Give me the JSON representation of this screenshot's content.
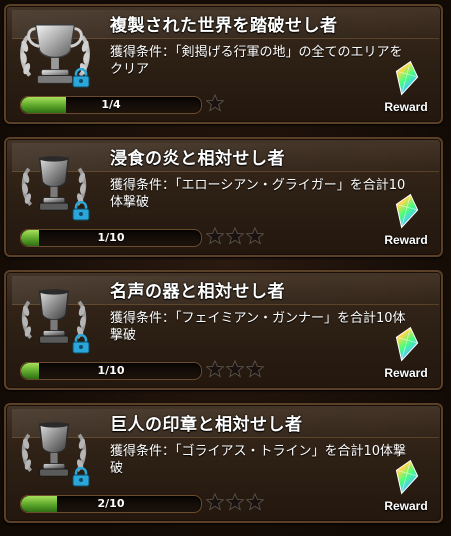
{
  "cards": [
    {
      "title": "複製された世界を踏破せし者",
      "condition": "獲得条件：「剣揭げる行軍の地」の全てのエリアをクリア",
      "progress_text": "1/4",
      "progress_fraction": 0.25,
      "stars": 1,
      "reward_label": "Reward",
      "trophy": "silver-trophy-laurel-icon"
    },
    {
      "title": "浸食の炎と相対せし者",
      "condition": "獲得条件：「エローシアン・グライガー」を合計10体撃破",
      "progress_text": "1/10",
      "progress_fraction": 0.1,
      "stars": 3,
      "reward_label": "Reward",
      "trophy": "silver-trophy-laurel-icon"
    },
    {
      "title": "名声の器と相対せし者",
      "condition": "獲得条件：「フェイミアン・ガンナー」を合計10体撃破",
      "progress_text": "1/10",
      "progress_fraction": 0.1,
      "stars": 3,
      "reward_label": "Reward",
      "trophy": "silver-trophy-laurel-icon"
    },
    {
      "title": "巨人の印章と相対せし者",
      "condition": "獲得条件：「ゴライアス・トライン」を合計10体撃破",
      "progress_text": "2/10",
      "progress_fraction": 0.2,
      "stars": 3,
      "reward_label": "Reward",
      "trophy": "silver-trophy-laurel-icon"
    }
  ],
  "colors": {
    "progress_green": "#5aa52a",
    "card_border": "#5a4026",
    "lock_blue": "#2aa7d8"
  },
  "icons": {
    "lock": "lock-icon",
    "star": "star-icon",
    "reward": "rainbow-crystal-icon"
  }
}
